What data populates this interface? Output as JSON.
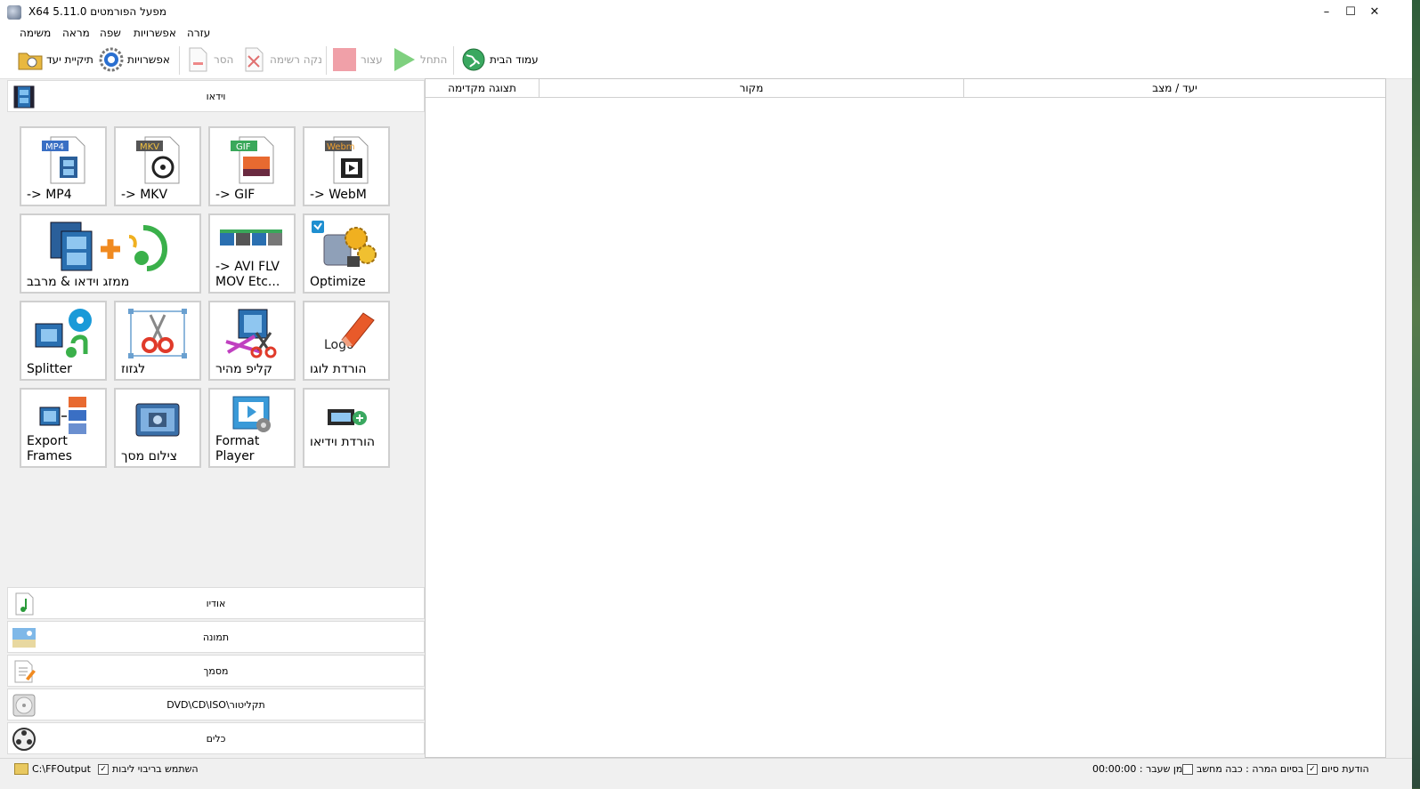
{
  "window": {
    "title": "X64 5.11.0 מפעל הפורמטים",
    "minimize": "–",
    "maximize": "☐",
    "close": "✕"
  },
  "menu": [
    "משימה",
    "מראה",
    "שפה",
    "אפשרויות",
    "עזרה"
  ],
  "toolbar": {
    "output_folder": "תיקיית יעד",
    "options": "אפשרויות",
    "remove": "הסר",
    "clear_list": "נקה רשימה",
    "stop": "עצור",
    "start": "התחל",
    "homepage": "עמוד הבית"
  },
  "categories": {
    "video": "וידאו",
    "audio": "אודיו",
    "picture": "תמונה",
    "document": "מסמך",
    "rom": "DVD\\CD\\ISO\\תקליטור",
    "tools": "כלים"
  },
  "tiles": [
    {
      "label": "-> MP4",
      "badge": "MP4",
      "badge_color": "#3a6fc4"
    },
    {
      "label": "-> MKV",
      "badge": "MKV",
      "badge_color": "#555555"
    },
    {
      "label": "-> GIF",
      "badge": "GIF",
      "badge_color": "#3aa85a"
    },
    {
      "label": "-> WebM",
      "badge": "Webm",
      "badge_color": "#555555"
    },
    {
      "label": "ממזג וידאו & מרבב"
    },
    {
      "label": "-> AVI FLV\nMOV Etc..."
    },
    {
      "label": "Optimize"
    },
    {
      "label": "Splitter"
    },
    {
      "label": "לגזוז"
    },
    {
      "label": "קליפ מהיר"
    },
    {
      "label": "הורדת לוגו",
      "art_text": "Logo"
    },
    {
      "label": "Export\nFrames"
    },
    {
      "label": "צילום מסך"
    },
    {
      "label": "Format\nPlayer"
    },
    {
      "label": "הורדת וידיאו"
    }
  ],
  "list_columns": {
    "preview": "תצוגה מקדימה",
    "source": "מקור",
    "output_status": "יעד / מצב"
  },
  "status": {
    "output_path": "C:\\FFOutput",
    "multithread": "השתמש בריבוי ליבות",
    "elapsed": "00:00:00 : זמן שעבר",
    "after_convert": "בסיום המרה : כבה מחשב",
    "complete_notify": "הודעת סיום"
  },
  "colors": {
    "accent": "#3a6fc4",
    "stop": "#f0a0a8",
    "start": "#7fd07f"
  }
}
